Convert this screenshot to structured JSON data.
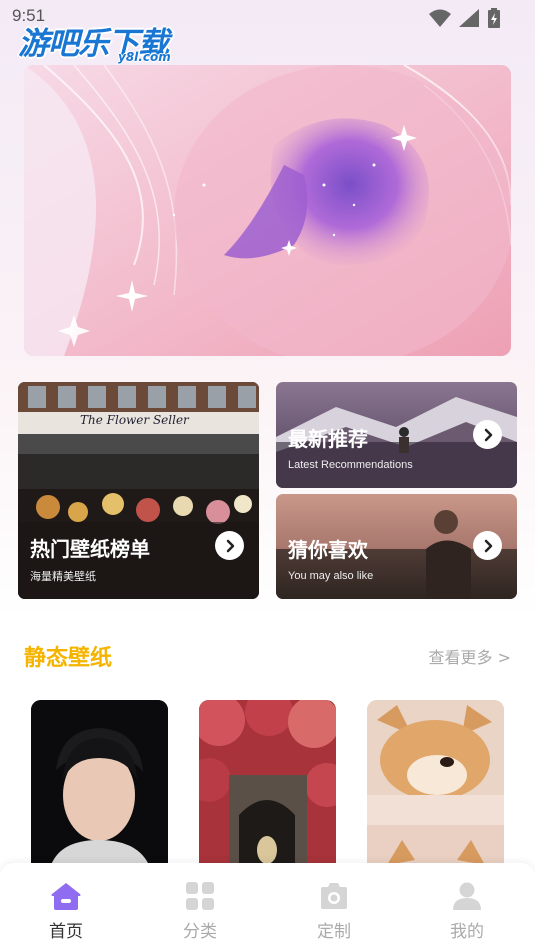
{
  "status_bar": {
    "time": "9:51"
  },
  "watermark": {
    "main": "游吧乐下载",
    "sub": "y8l.com"
  },
  "cards": {
    "hot": {
      "title": "热门壁纸榜单",
      "subtitle": "海量精美壁纸",
      "shop_sign": "The Flower Seller"
    },
    "latest": {
      "title": "最新推荐",
      "subtitle": "Latest Recommendations"
    },
    "guess": {
      "title": "猜你喜欢",
      "subtitle": "You may also like"
    }
  },
  "section": {
    "title": "静态壁纸",
    "more": "查看更多 >"
  },
  "tabs": [
    {
      "label": "首页",
      "icon": "home-icon",
      "active": true
    },
    {
      "label": "分类",
      "icon": "grid-icon",
      "active": false
    },
    {
      "label": "定制",
      "icon": "camera-icon",
      "active": false
    },
    {
      "label": "我的",
      "icon": "user-icon",
      "active": false
    }
  ],
  "colors": {
    "accent": "#f5b400",
    "tab_active": "#8f6cf0",
    "tab_inactive": "#d5d5d5"
  }
}
